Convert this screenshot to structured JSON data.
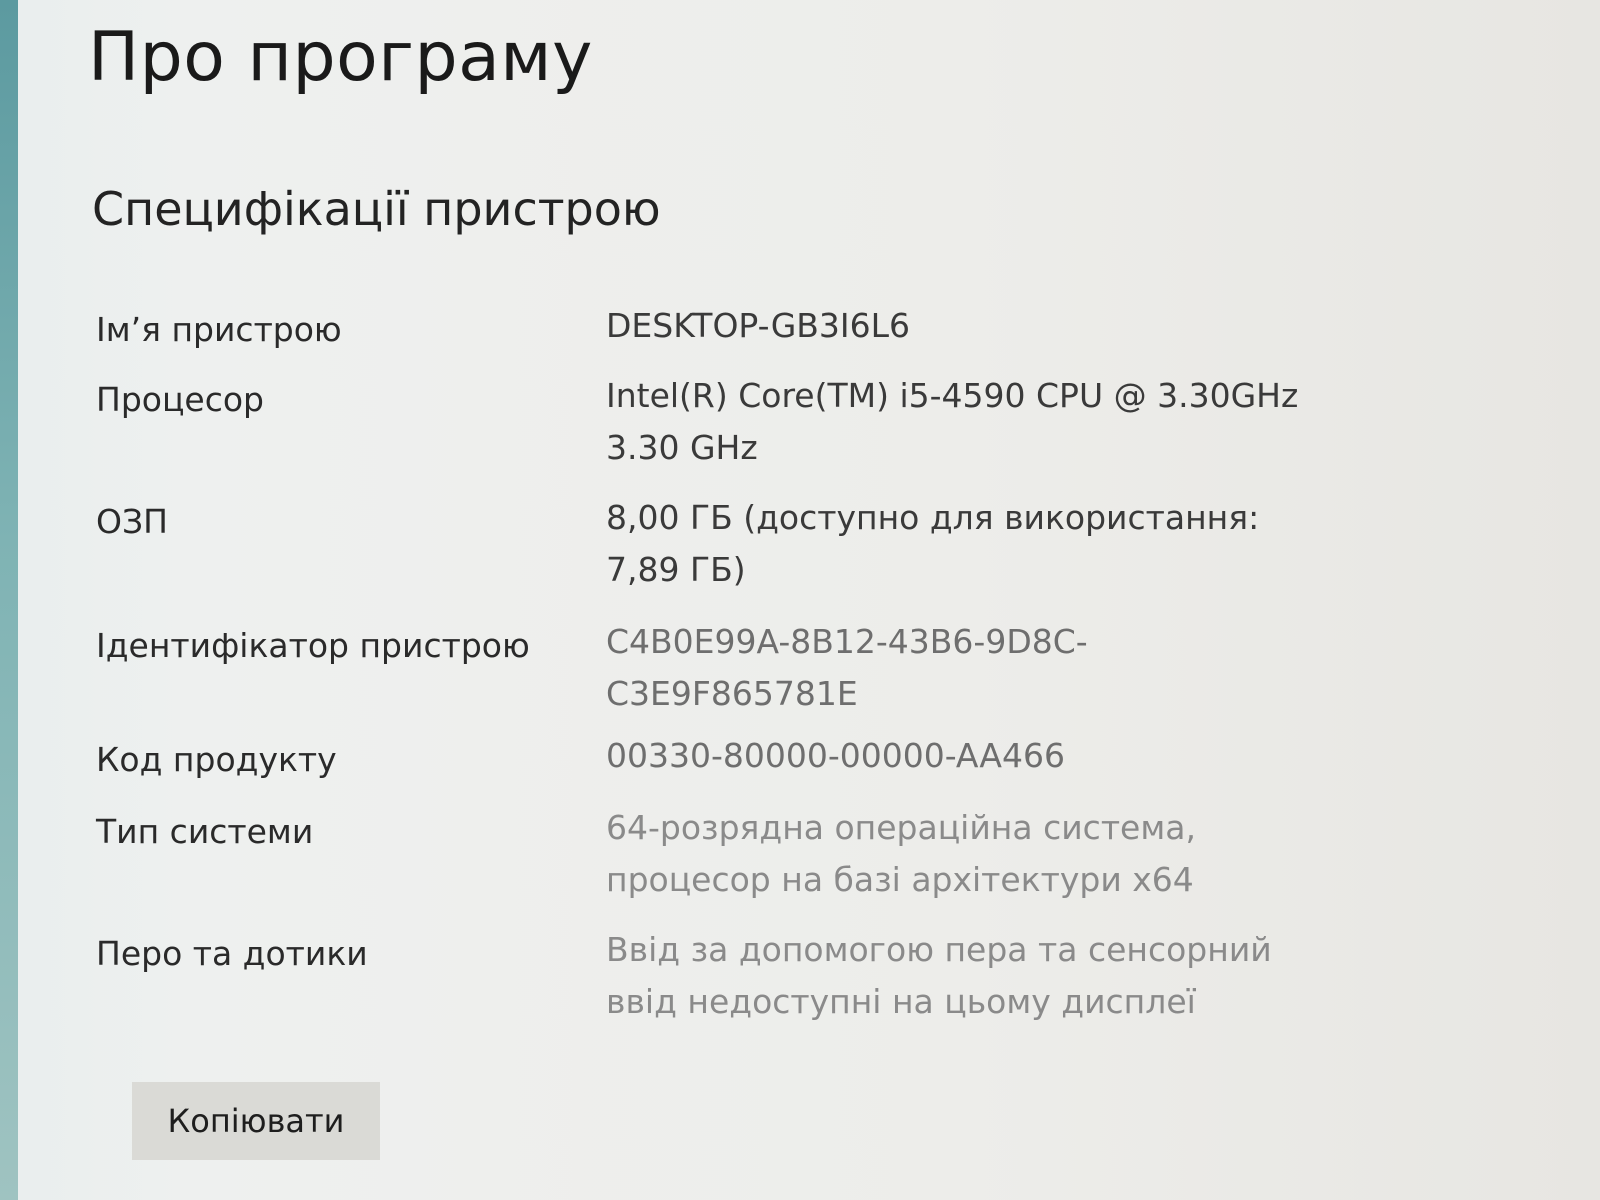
{
  "page": {
    "title": "Про програму"
  },
  "device_specs": {
    "heading": "Специфікації пристрою",
    "rows": [
      {
        "label": "Ім’я пристрою",
        "value": "DESKTOP-GB3I6L6"
      },
      {
        "label": "Процесор",
        "value": "Intel(R) Core(TM) i5-4590 CPU @ 3.30GHz 3.30 GHz"
      },
      {
        "label": "ОЗП",
        "value": "8,00 ГБ (доступно для використання: 7,89 ГБ)"
      },
      {
        "label": "Ідентифікатор пристрою",
        "value": "C4B0E99A-8B12-43B6-9D8C-C3E9F865781E"
      },
      {
        "label": "Код продукту",
        "value": "00330-80000-00000-AA466"
      },
      {
        "label": "Тип системи",
        "value": "64-розрядна операційна система, процесор на базі архітектури x64"
      },
      {
        "label": "Перо та дотики",
        "value": "Ввід за допомогою пера та сенсорний ввід недоступні на цьому дисплеї"
      }
    ],
    "copy_label": "Копіювати"
  }
}
